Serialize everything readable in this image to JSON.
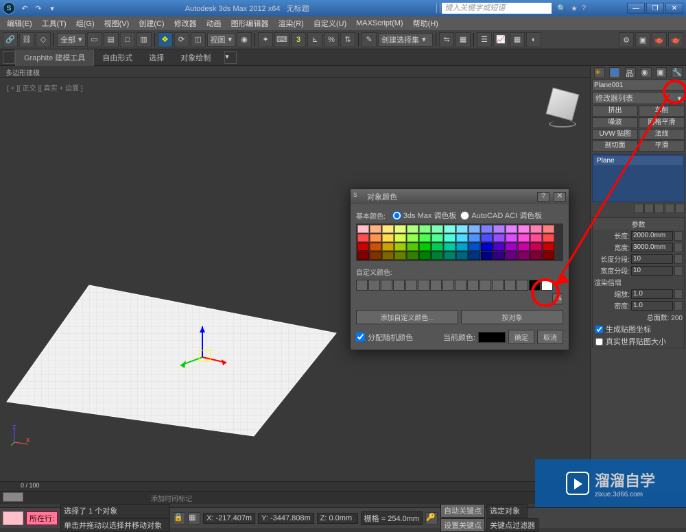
{
  "titlebar": {
    "app": "Autodesk 3ds Max 2012 x64",
    "doc": "无标题",
    "search": "键入关键字或短语"
  },
  "menubar": [
    "编辑(E)",
    "工具(T)",
    "组(G)",
    "视图(V)",
    "创建(C)",
    "修改器",
    "动画",
    "图形编辑器",
    "渲染(R)",
    "自定义(U)",
    "MAXScript(M)",
    "帮助(H)"
  ],
  "toolbar": {
    "selset": "全部",
    "named": "创建选择集",
    "view": "视图"
  },
  "ribbon": {
    "tabs": [
      "Graphite 建模工具",
      "自由形式",
      "选择",
      "对象绘制"
    ],
    "sub": "多边形建模"
  },
  "viewport": {
    "label": "[ + ][ 正交 ][ 真实 + 边面 ]"
  },
  "rightpanel": {
    "objname": "Plane001",
    "modlist": "修改器列表",
    "modbtns": [
      "挤出",
      "车削",
      "噪波",
      "网格平滑",
      "UVW 贴图",
      "法线",
      "剖切面",
      "平滑"
    ],
    "stackitem": "Plane",
    "rollout_params": "参数",
    "length_lbl": "长度:",
    "length": "2000.0mm",
    "width_lbl": "宽度:",
    "width": "3000.0mm",
    "lseg_lbl": "长度分段:",
    "lseg": "10",
    "wseg_lbl": "宽度分段:",
    "wseg": "10",
    "rendermult": "渲染倍增",
    "scale_lbl": "缩放:",
    "scale": "1.0",
    "density_lbl": "密度:",
    "density": "1.0",
    "faces": "总面数: 200",
    "gen_uv": "生成贴图坐标",
    "real_world": "真实世界贴图大小"
  },
  "dialog": {
    "title": "对象颜色",
    "basic": "基本颜色:",
    "r1": "3ds Max 调色板",
    "r2": "AutoCAD ACI 调色板",
    "custom": "自定义颜色:",
    "addcustom": "添加自定义颜色...",
    "byobj": "按对象",
    "assign": "分配随机颜色",
    "current": "当前颜色:",
    "ok": "确定",
    "cancel": "取消"
  },
  "palette_rows": [
    [
      "#ffc0cb",
      "#ffb380",
      "#ffe680",
      "#e6ff80",
      "#b3ff80",
      "#80ff80",
      "#80ffb3",
      "#80ffe6",
      "#80e6ff",
      "#80b3ff",
      "#8080ff",
      "#b380ff",
      "#e680ff",
      "#ff80e6",
      "#ff80b3",
      "#ff8080"
    ],
    [
      "#ff4d4d",
      "#ff944d",
      "#ffdb4d",
      "#dbff4d",
      "#94ff4d",
      "#4dff4d",
      "#4dff94",
      "#4dffdb",
      "#4ddbff",
      "#4d94ff",
      "#4d4dff",
      "#944dff",
      "#db4dff",
      "#ff4ddb",
      "#ff4d94",
      "#ff4d4d"
    ],
    [
      "#cc0000",
      "#cc5200",
      "#cca300",
      "#a3cc00",
      "#52cc00",
      "#00cc00",
      "#00cc52",
      "#00cca3",
      "#00a3cc",
      "#0052cc",
      "#0000cc",
      "#5200cc",
      "#a300cc",
      "#cc00a3",
      "#cc0052",
      "#cc0000"
    ],
    [
      "#800000",
      "#803300",
      "#806600",
      "#668000",
      "#338000",
      "#008000",
      "#008033",
      "#008066",
      "#006680",
      "#003380",
      "#000080",
      "#330080",
      "#660080",
      "#800066",
      "#800033",
      "#800000"
    ]
  ],
  "trackbar": {
    "range": "0 / 100",
    "add_tag": "添加时间标记"
  },
  "status": {
    "prompt": "所在行:",
    "sel": "选择了 1 个对象",
    "hint": "单击并拖动以选择并移动对象",
    "x": "X: -217.407m",
    "y": "Y: -3447.808m",
    "z": "Z: 0.0mm",
    "grid": "栅格 = 254.0mm",
    "auto": "自动关键点",
    "selset": "选定对象",
    "setkey": "设置关键点",
    "keyfilter": "关键点过滤器"
  },
  "watermark": {
    "big": "溜溜自学",
    "small": "zixue.3d66.com"
  }
}
